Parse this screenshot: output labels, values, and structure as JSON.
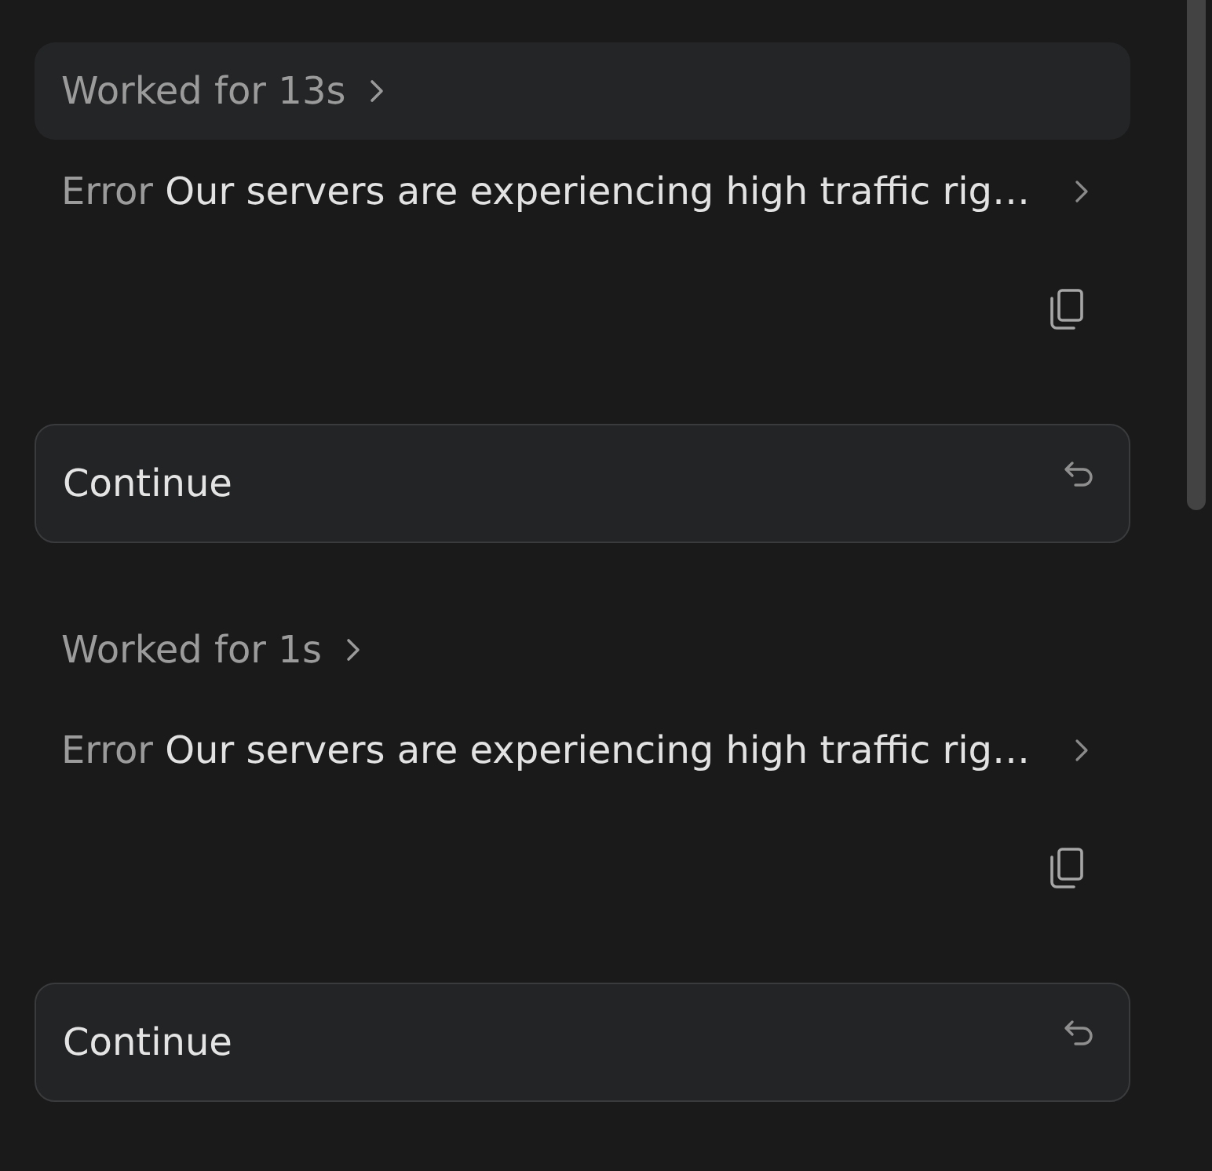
{
  "turns": [
    {
      "worked": {
        "label": "Worked for 13s",
        "highlighted": true
      },
      "error": {
        "label": "Error",
        "message": "Our servers are experiencing high traffic rig…"
      },
      "continue_button": {
        "label": "Continue"
      }
    },
    {
      "worked": {
        "label": "Worked for 1s",
        "highlighted": false
      },
      "error": {
        "label": "Error",
        "message": "Our servers are experiencing high traffic rig…"
      },
      "continue_button": {
        "label": "Continue"
      }
    }
  ]
}
